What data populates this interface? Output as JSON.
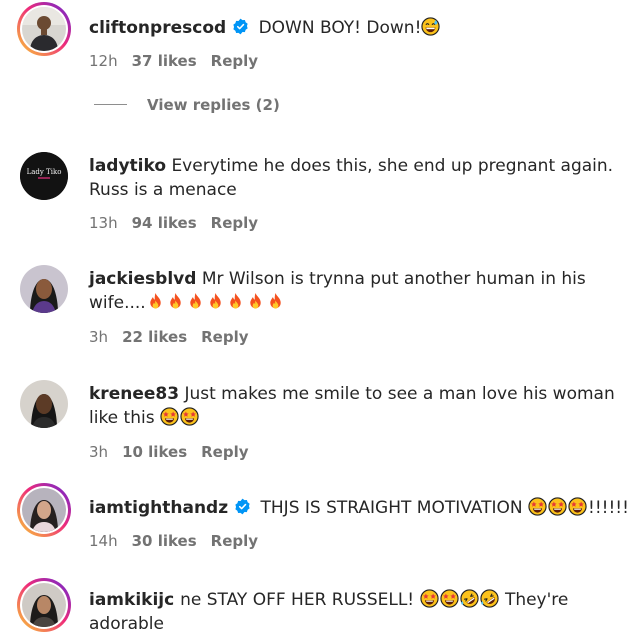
{
  "comments": [
    {
      "username": "cliftonprescod",
      "verified": true,
      "text": "DOWN BOY! Down!",
      "emojis": [
        "grinning-sweat-face"
      ],
      "time": "12h",
      "likes": "37 likes",
      "reply": "Reply",
      "view_replies": "View replies (2)"
    },
    {
      "username": "ladytiko",
      "verified": false,
      "avatar_text": "Lady Tiko",
      "text_line1": "Everytime he does this, she end up pregnant again.",
      "text_line2": "Russ is a menace",
      "time": "13h",
      "likes": "94 likes",
      "reply": "Reply"
    },
    {
      "username": "jackiesblvd",
      "verified": false,
      "text_line1": "Mr Wilson is trynna put another human in his",
      "text_line2": "wife....",
      "emojis": [
        "fire",
        "fire",
        "fire",
        "fire",
        "fire",
        "fire",
        "fire"
      ],
      "time": "3h",
      "likes": "22 likes",
      "reply": "Reply"
    },
    {
      "username": "krenee83",
      "verified": false,
      "text_line1": "Just makes me smile to see a man love his woman",
      "text_line2": "like this",
      "emojis": [
        "star-struck",
        "star-struck"
      ],
      "time": "3h",
      "likes": "10 likes",
      "reply": "Reply"
    },
    {
      "username": "iamtighthandz",
      "verified": true,
      "text": "THJS IS STRAIGHT MOTIVATION",
      "emojis": [
        "star-struck",
        "star-struck",
        "star-struck"
      ],
      "text_suffix": "!!!!!!",
      "time": "14h",
      "likes": "30 likes",
      "reply": "Reply"
    },
    {
      "username_partial": "iamkikijc",
      "username_glitch": "ne",
      "text_start": "STAY OFF HER RUSSELL!",
      "emojis": [
        "star-struck",
        "star-struck",
        "rolling-laughing",
        "rolling-laughing"
      ],
      "text_line1_end": "They're",
      "text_line2": "adorable"
    }
  ],
  "colors": {
    "text": "#262626",
    "meta": "#737373",
    "verified": "#0095f6",
    "ring_start": "#f9ce34",
    "ring_mid": "#ee2a7b",
    "ring_end": "#6228d7"
  }
}
